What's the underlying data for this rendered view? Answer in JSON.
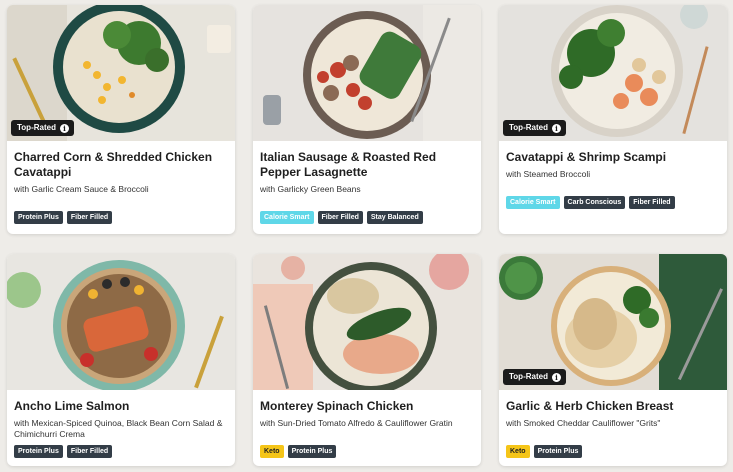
{
  "cards": [
    {
      "title": "Charred Corn & Shredded Chicken Cavatappi",
      "subtitle": "with Garlic Cream Sauce & Broccoli",
      "top_rated": "Top-Rated",
      "tags": [
        "Protein Plus",
        "Fiber Filled"
      ]
    },
    {
      "title": "Italian Sausage & Roasted Red Pepper Lasagnette",
      "subtitle": "with Garlicky Green Beans",
      "tags": [
        "Calorie Smart",
        "Fiber Filled",
        "Stay Balanced"
      ]
    },
    {
      "title": "Cavatappi & Shrimp Scampi",
      "subtitle": "with Steamed Broccoli",
      "top_rated": "Top-Rated",
      "tags": [
        "Calorie Smart",
        "Carb Conscious",
        "Fiber Filled"
      ]
    },
    {
      "title": "Ancho Lime Salmon",
      "subtitle": "with Mexican-Spiced Quinoa, Black Bean Corn Salad & Chimichurri Crema",
      "tags": [
        "Protein Plus",
        "Fiber Filled"
      ]
    },
    {
      "title": "Monterey Spinach Chicken",
      "subtitle": "with Sun-Dried Tomato Alfredo & Cauliflower Gratin",
      "tags": [
        "Keto",
        "Protein Plus"
      ]
    },
    {
      "title": "Garlic & Herb Chicken Breast",
      "subtitle": "with Smoked Cheddar Cauliflower \"Grits\"",
      "top_rated": "Top-Rated",
      "tags": [
        "Keto",
        "Protein Plus"
      ]
    }
  ],
  "colors": {
    "tag_default": "#333d47",
    "tag_calorie_smart": "#5fd7e8",
    "tag_keto": "#f5c518",
    "top_rated_badge": "#1b1b1b"
  },
  "icons": {
    "badge_info": "info-icon"
  }
}
